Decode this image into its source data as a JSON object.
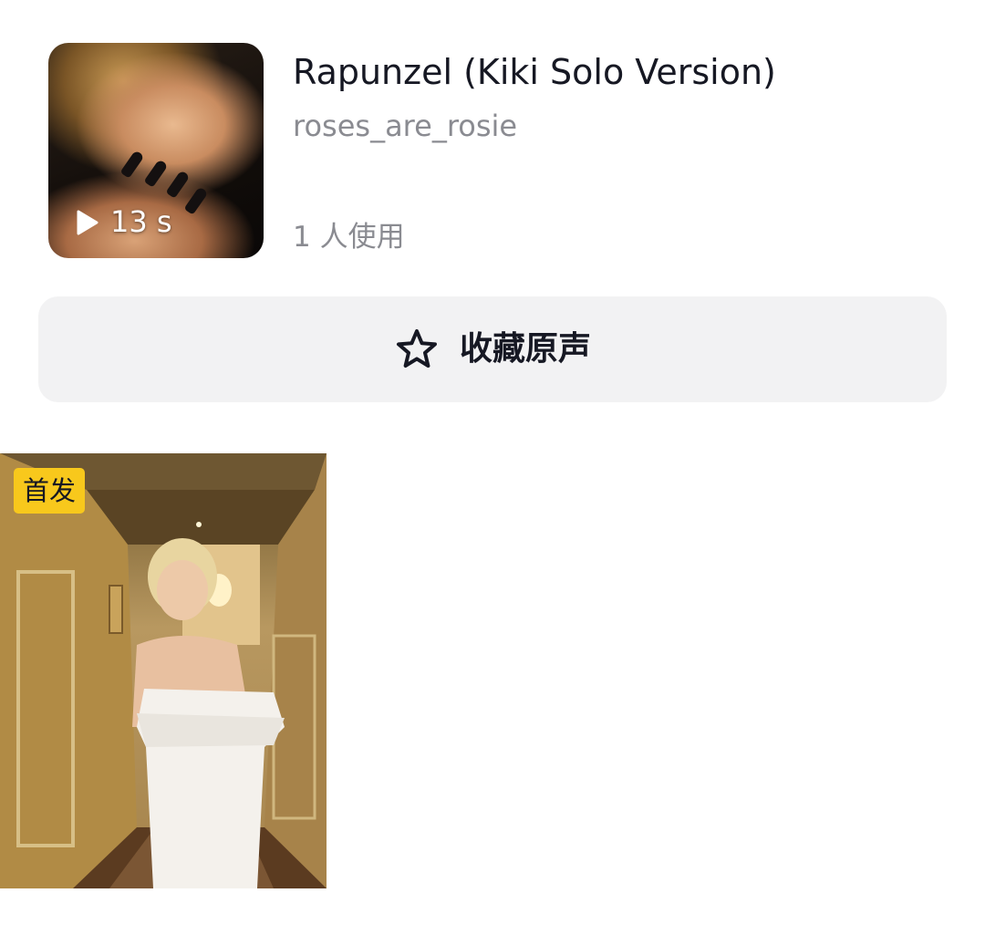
{
  "music": {
    "title": "Rapunzel (Kiki Solo Version)",
    "author": "roses_are_rosie",
    "duration": "13 s",
    "usage": "1 人使用"
  },
  "favorite": {
    "label": "收藏原声",
    "icon": "star-outline-icon"
  },
  "videos": [
    {
      "badge": "首发"
    }
  ],
  "colors": {
    "text_primary": "#161823",
    "text_secondary": "#8a8b91",
    "button_bg": "#f2f2f3",
    "badge_bg": "#f8c81c"
  }
}
